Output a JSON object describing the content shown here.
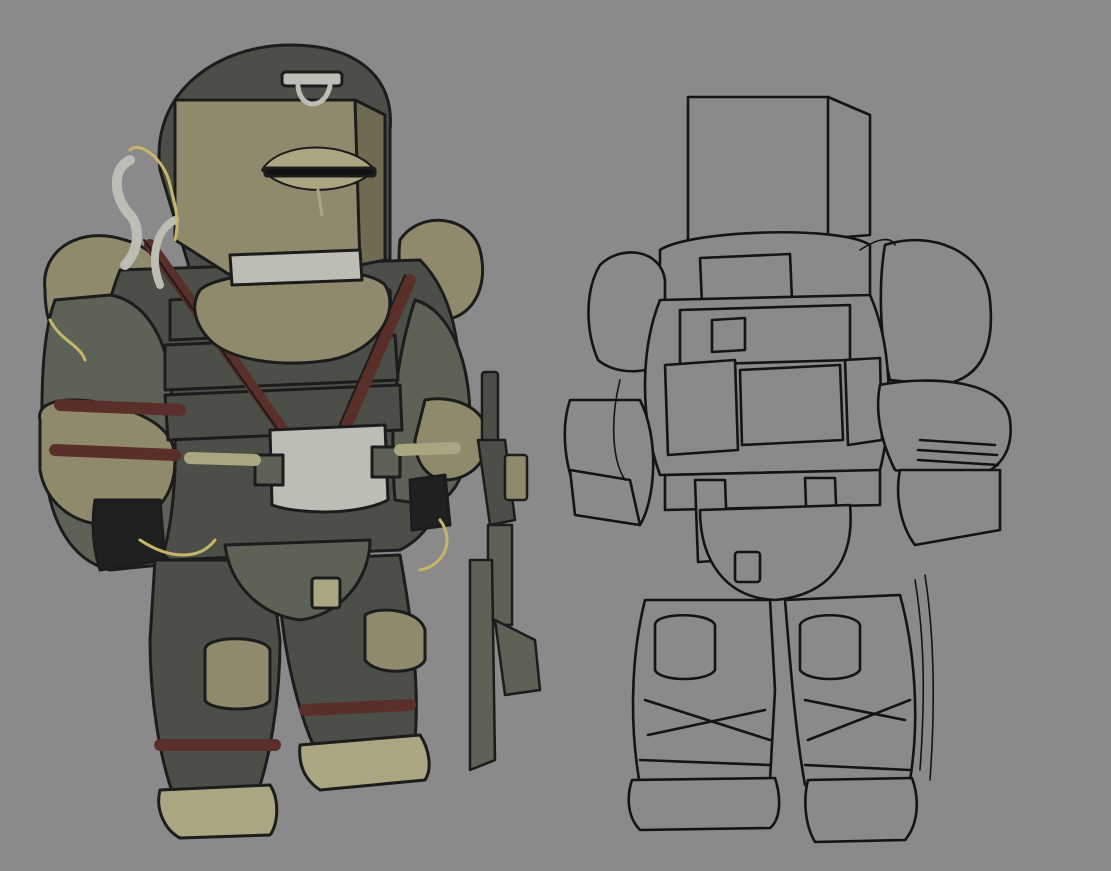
{
  "colors": {
    "background": "#8a8a8a",
    "suit_dark": "#4b4f47",
    "suit_mid": "#5d6156",
    "khaki": "#8f8a6c",
    "khaki_light": "#aba682",
    "straps": "#5a2f2a",
    "metal": "#bdbcb5",
    "line": "#1c1c1c",
    "sketch_fill": "#8a8a8a"
  },
  "figures": [
    {
      "name": "colored-armored-soldier",
      "style": "painted"
    },
    {
      "name": "lineart-armored-soldier",
      "style": "sketch"
    }
  ],
  "props": [
    {
      "name": "rifle-icon"
    },
    {
      "name": "box-helmet-icon"
    }
  ]
}
